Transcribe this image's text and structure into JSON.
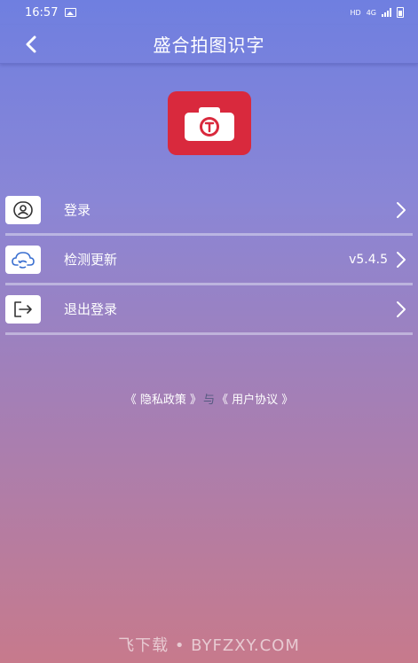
{
  "status_bar": {
    "time": "16:57",
    "hd": "HD",
    "network": "4G"
  },
  "app_bar": {
    "title": "盛合拍图识字"
  },
  "menu": {
    "items": [
      {
        "label": "登录",
        "icon": "user-icon",
        "value": ""
      },
      {
        "label": "检测更新",
        "icon": "cloud-sync-icon",
        "value": "v5.4.5"
      },
      {
        "label": "退出登录",
        "icon": "logout-icon",
        "value": ""
      }
    ]
  },
  "policy": {
    "privacy": "《 隐私政策 》",
    "and": "与",
    "agreement": "《 用户协议 》"
  },
  "watermark": "飞下载 • BYFZXY.COM",
  "colors": {
    "logo_red": "#d9293d",
    "icon_blue": "#3a6fd0"
  }
}
